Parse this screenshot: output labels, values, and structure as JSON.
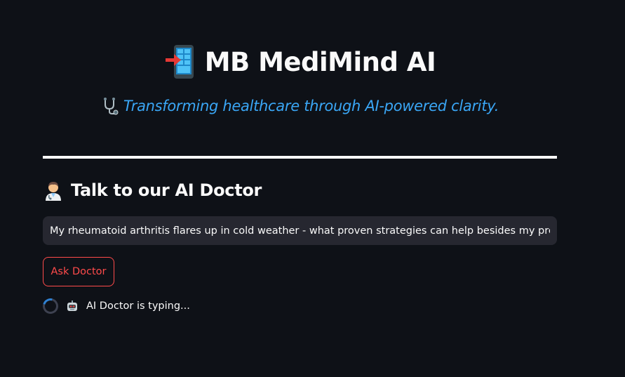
{
  "header": {
    "title": "MB MediMind AI",
    "title_icon": "mobile-phone-arrow-icon",
    "subtitle": "Transforming healthcare through AI-powered clarity.",
    "subtitle_icon": "stethoscope-icon"
  },
  "chat": {
    "heading": "Talk to our AI Doctor",
    "heading_icon": "health-worker-icon",
    "question_value": "My rheumatoid arthritis flares up in cold weather - what proven strategies can help besides my prescribed",
    "ask_button_label": "Ask Doctor",
    "status_text": "AI Doctor is typing...",
    "status_icon": "robot-icon"
  },
  "colors": {
    "background": "#0e1117",
    "text": "#fafafa",
    "subtitle": "#3aa6f5",
    "input_background": "#262730",
    "accent_red": "#ff4b4b",
    "spinner": "#2f80d1"
  }
}
